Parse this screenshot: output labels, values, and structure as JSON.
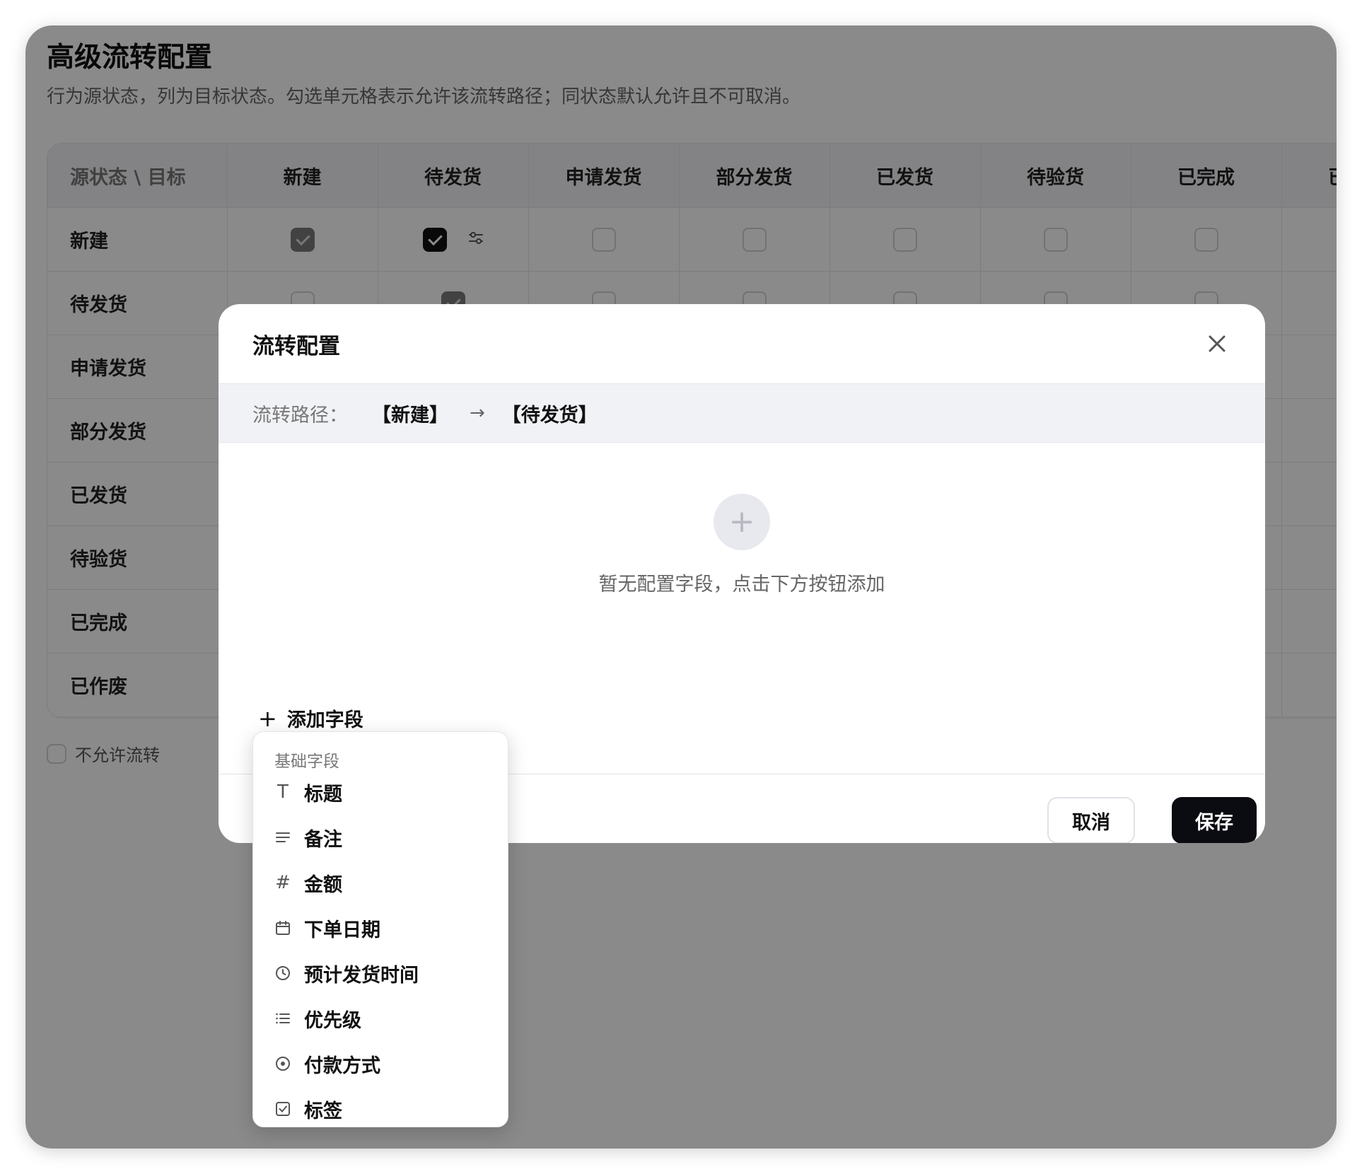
{
  "page": {
    "title": "高级流转配置",
    "description": "行为源状态，列为目标状态。勾选单元格表示允许该流转路径；同状态默认允许且不可取消。"
  },
  "matrix": {
    "corner": "源状态 \\ 目标",
    "columns": [
      "新建",
      "待发货",
      "申请发货",
      "部分发货",
      "已发货",
      "待验货",
      "已完成",
      "已作废"
    ],
    "rows": [
      {
        "label": "新建",
        "cells": [
          "on-disabled",
          "on-config",
          "off",
          "off",
          "off",
          "off",
          "off",
          "off"
        ]
      },
      {
        "label": "待发货",
        "cells": [
          "off",
          "on-disabled",
          "off",
          "off",
          "off",
          "off",
          "off",
          "off"
        ]
      },
      {
        "label": "申请发货",
        "cells": [
          "off",
          "off",
          "on-disabled",
          "off",
          "off",
          "off",
          "off",
          "off"
        ]
      },
      {
        "label": "部分发货",
        "cells": [
          "off",
          "off",
          "off",
          "on-disabled",
          "off",
          "off",
          "off",
          "off"
        ]
      },
      {
        "label": "已发货",
        "cells": [
          "off",
          "off",
          "off",
          "off",
          "on-disabled",
          "off",
          "off",
          "off"
        ]
      },
      {
        "label": "待验货",
        "cells": [
          "off",
          "off",
          "off",
          "off",
          "off",
          "on-disabled",
          "off",
          "off"
        ]
      },
      {
        "label": "已完成",
        "cells": [
          "off",
          "off",
          "off",
          "off",
          "off",
          "off",
          "on-disabled",
          "off"
        ]
      },
      {
        "label": "已作废",
        "cells": [
          "off",
          "off",
          "off",
          "off",
          "off",
          "off",
          "off",
          "on-disabled"
        ]
      }
    ]
  },
  "legend": {
    "disallow_label": "不允许流转"
  },
  "modal": {
    "title": "流转配置",
    "path_label": "流转路径：",
    "path_from": "【新建】",
    "path_arrow": "→",
    "path_to": "【待发货】",
    "empty_plus": "+",
    "empty_text": "暂无配置字段，点击下方按钮添加",
    "add_plus": "+",
    "add_field_label": "添加字段",
    "cancel_label": "取消",
    "save_label": "保存"
  },
  "dropdown": {
    "group_label": "基础字段",
    "items": [
      {
        "icon": "text-type-icon",
        "label": "标题"
      },
      {
        "icon": "text-lines-icon",
        "label": "备注"
      },
      {
        "icon": "hash-icon",
        "label": "金额"
      },
      {
        "icon": "calendar-icon",
        "label": "下单日期"
      },
      {
        "icon": "clock-icon",
        "label": "预计发货时间"
      },
      {
        "icon": "list-icon",
        "label": "优先级"
      },
      {
        "icon": "radio-icon",
        "label": "付款方式"
      },
      {
        "icon": "checkbox-icon",
        "label": "标签"
      }
    ]
  },
  "colors": {
    "primary": "#0b0b12",
    "overlay": "rgba(0,0,0,0.46)",
    "header_bg": "#f2f3f6",
    "border": "#e3e5ea"
  }
}
